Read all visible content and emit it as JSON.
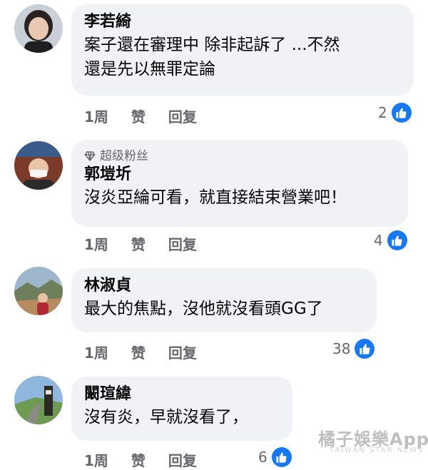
{
  "comments": [
    {
      "name": "李若綺",
      "lines": [
        "案子還在審理中 除非起訴了 ...不然",
        "還是先以無罪定論"
      ],
      "time": "1周",
      "like_label": "赞",
      "reply_label": "回复",
      "reactions": "2"
    },
    {
      "badge": "超级粉丝",
      "name": "郭塏圻",
      "lines": [
        "沒炎亞綸可看，就直接結束營業吧！"
      ],
      "time": "1周",
      "like_label": "赞",
      "reply_label": "回复",
      "reactions": "4"
    },
    {
      "name": "林淑貞",
      "lines": [
        "最大的焦點，沒他就沒看頭GG了"
      ],
      "time": "1周",
      "like_label": "赞",
      "reply_label": "回复",
      "reactions": "38"
    },
    {
      "name": "闞瑄緯",
      "lines": [
        "沒有炎，早就沒看了，"
      ],
      "time": "1周",
      "like_label": "赞",
      "reply_label": "回复",
      "reactions": "6"
    }
  ],
  "watermark": {
    "main": "橘子娛樂App",
    "sub": "TAIWAN STAR NEWS"
  },
  "icons": {
    "like": "thumbs-up-icon",
    "badge": "diamond-icon"
  },
  "colors": {
    "like_blue": "#1877f2",
    "bubble": "#f0f2f5",
    "meta": "#65676b"
  }
}
